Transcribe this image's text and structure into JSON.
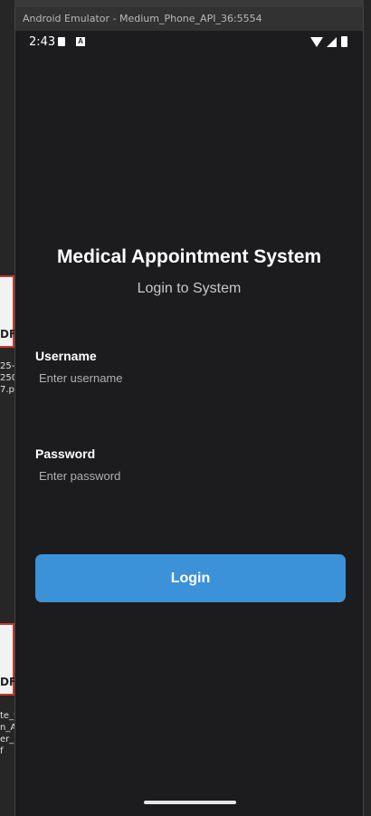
{
  "window": {
    "title": "Android Emulator - Medium_Phone_API_36:5554"
  },
  "status_bar": {
    "time": "2:43",
    "icons": [
      "sd-card-icon",
      "a-notification-icon",
      "wifi-icon",
      "signal-icon",
      "battery-icon"
    ]
  },
  "app": {
    "title": "Medical Appointment System",
    "subtitle": "Login to System"
  },
  "form": {
    "username_label": "Username",
    "username_placeholder": "Enter username",
    "password_label": "Password",
    "password_placeholder": "Enter password",
    "login_label": "Login"
  },
  "desktop": {
    "file1_lines": "25-\n250\n7.p",
    "file2_lines": "te_v\nn_A\ner_L\nf",
    "pdf_label": "DF"
  },
  "colors": {
    "background": "#1c1c1e",
    "accent": "#3b92d8",
    "text": "#ffffff"
  }
}
